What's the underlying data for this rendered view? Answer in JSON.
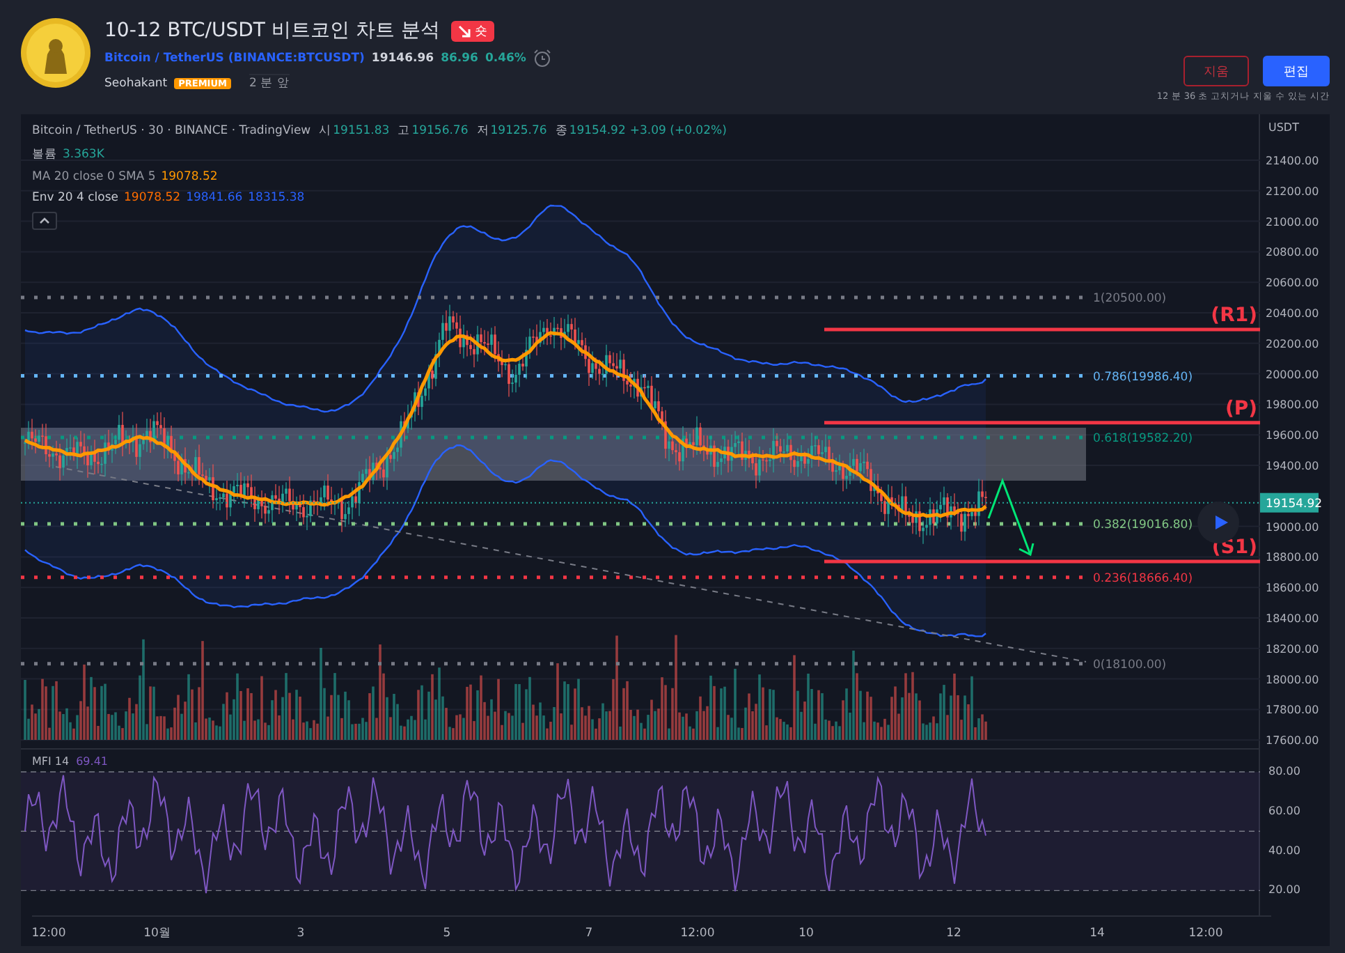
{
  "idea": {
    "title": "10-12 BTC/USDT 비트코인 차트 분석",
    "badge": "숏",
    "symbol": "Bitcoin / TetherUS",
    "exchange": "(BINANCE:BTCUSDT)",
    "price": "19146.96",
    "change": "86.96",
    "change_pct": "0.46%",
    "author": "Seohakant",
    "author_badge": "PREMIUM",
    "time": "2 분 앞"
  },
  "actions": {
    "delete": "지움",
    "edit": "편집",
    "note": "12 분 36 초 고치거나 지울 수 있는 시간"
  },
  "legend": {
    "title": "Bitcoin / TetherUS · 30 · BINANCE · TradingView",
    "ohlc": [
      {
        "label": "시",
        "value": "19151.83"
      },
      {
        "label": "고",
        "value": "19156.76"
      },
      {
        "label": "저",
        "value": "19125.76"
      },
      {
        "label": "종",
        "value": "19154.92"
      }
    ],
    "change": "+3.09 (+0.02%)",
    "indicators": [
      {
        "kind": "volume",
        "name": "볼륨",
        "values": [
          {
            "text": "3.363K",
            "color": "#26a69a"
          }
        ]
      },
      {
        "kind": "ma",
        "name": "MA 20 close 0 SMA 5",
        "values": [
          {
            "text": "19078.52",
            "color": "#ff9800"
          }
        ]
      },
      {
        "kind": "env",
        "name": "Env 20 4 close",
        "values": [
          {
            "text": "19078.52",
            "color": "#ff6d00"
          },
          {
            "text": "19841.66",
            "color": "#2962ff"
          },
          {
            "text": "18315.38",
            "color": "#2962ff"
          }
        ]
      }
    ]
  },
  "fib_levels": [
    {
      "label": "1(20500.00)",
      "color": "#787b86"
    },
    {
      "label": "0.786(19986.40)",
      "color": "#64b5f6"
    },
    {
      "label": "0.618(19582.20)",
      "color": "#089981"
    },
    {
      "label": "0.382(19016.80)",
      "color": "#81c784"
    },
    {
      "label": "0.236(18666.40)",
      "color": "#f23645"
    },
    {
      "label": "0(18100.00)",
      "color": "#787b86"
    }
  ],
  "pivots": [
    {
      "label": "(R1)"
    },
    {
      "label": "(P)"
    },
    {
      "label": "(S1)"
    }
  ],
  "price_axis": {
    "unit": "USDT",
    "ticks": [
      "21400.00",
      "21200.00",
      "21000.00",
      "20800.00",
      "20600.00",
      "20400.00",
      "20200.00",
      "20000.00",
      "19800.00",
      "19600.00",
      "19400.00",
      "19000.00",
      "18800.00",
      "18600.00",
      "18400.00",
      "18200.00",
      "18000.00",
      "17800.00",
      "17600.00"
    ],
    "last_price": "19154.92"
  },
  "mfi": {
    "name": "MFI 14",
    "value": "69.41",
    "ticks": [
      "80.00",
      "60.00",
      "40.00",
      "20.00"
    ]
  },
  "time_axis": [
    "12:00",
    "10월",
    "3",
    "5",
    "7",
    "12:00",
    "10",
    "12",
    "14",
    "12:00"
  ]
}
